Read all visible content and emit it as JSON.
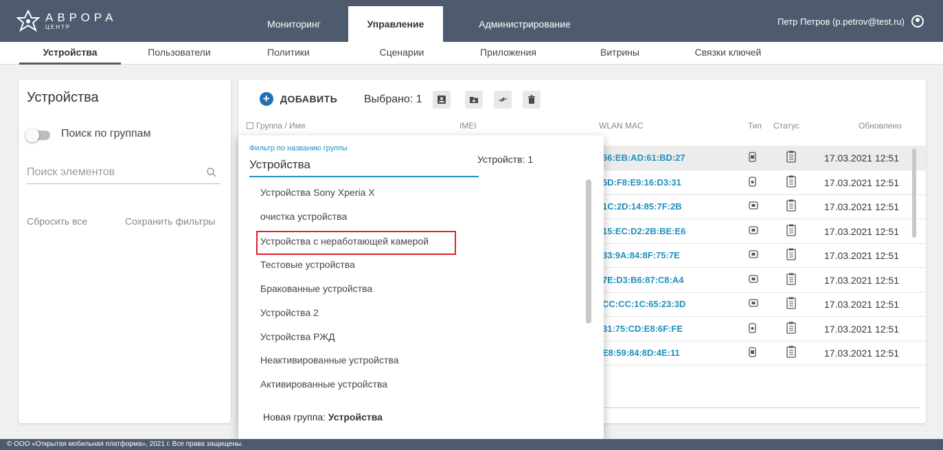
{
  "brand": {
    "title": "АВРОРА",
    "subtitle": "ЦЕНТР"
  },
  "main_tabs": [
    {
      "label": "Мониторинг"
    },
    {
      "label": "Управление"
    },
    {
      "label": "Администрирование"
    }
  ],
  "user": {
    "name": "Петр Петров (p.petrov@test.ru)"
  },
  "sub_nav": [
    {
      "label": "Устройства"
    },
    {
      "label": "Пользователи"
    },
    {
      "label": "Политики"
    },
    {
      "label": "Сценарии"
    },
    {
      "label": "Приложения"
    },
    {
      "label": "Витрины"
    },
    {
      "label": "Связки ключей"
    }
  ],
  "left_panel": {
    "title": "Устройства",
    "group_search_label": "Поиск по группам",
    "search_placeholder": "Поиск элементов",
    "reset_label": "Сбросить все",
    "save_label": "Сохранить фильтры"
  },
  "toolbar": {
    "add_label": "ДОБАВИТЬ",
    "selected_label": "Выбрано: 1"
  },
  "columns": {
    "name": "Группа / Имя",
    "imei": "IMEI",
    "wlan": "WLAN MAC",
    "type": "Тип",
    "status": "Статус",
    "updated": "Обновлено"
  },
  "rows": [
    {
      "mac": "56:EB:AD:61:BD:27",
      "type": "phone",
      "updated": "17.03.2021 12:51"
    },
    {
      "mac": "5D:F8:E9:16:D3:31",
      "type": "phone-alt",
      "updated": "17.03.2021 12:51"
    },
    {
      "mac": "1C:2D:14:85:7F:2B",
      "type": "tablet",
      "updated": "17.03.2021 12:51"
    },
    {
      "mac": "15:EC:D2:2B:BE:E6",
      "type": "tablet",
      "updated": "17.03.2021 12:51"
    },
    {
      "mac": "33:9A:84:8F:75:7E",
      "type": "tablet",
      "updated": "17.03.2021 12:51"
    },
    {
      "mac": "7E:D3:B6:87:C8:A4",
      "type": "tablet",
      "updated": "17.03.2021 12:51"
    },
    {
      "mac": "CC:CC:1C:65:23:3D",
      "type": "tablet",
      "updated": "17.03.2021 12:51"
    },
    {
      "mac": "31:75:CD:E8:6F:FE",
      "type": "phone-alt",
      "updated": "17.03.2021 12:51"
    },
    {
      "mac": "E8:59:84:8D:4E:11",
      "type": "phone",
      "updated": "17.03.2021 12:51"
    }
  ],
  "dropdown": {
    "filter_label": "Фильтр по названию группы",
    "filter_value": "Устройства",
    "count_label": "Устройств: 1",
    "items": [
      "Устройства Sony Xperia X",
      "очистка устройства",
      "Устройства с неработающей камерой",
      "Тестовые устройства",
      "Бракованные устройства",
      "Устройства 2",
      "Устройства РЖД",
      "Неактивированные устройства",
      "Активированные устройства"
    ],
    "new_group_prefix": "Новая группа:",
    "new_group_name": "Устройства"
  },
  "footer": {
    "text": "© ООО «Открытая мобильная платформа», 2021 г. Все права защищены."
  },
  "colors": {
    "header": "#4e5b6e",
    "accent": "#1f8fbf",
    "add_button": "#1f6fb4",
    "highlight": "#e0202b"
  }
}
